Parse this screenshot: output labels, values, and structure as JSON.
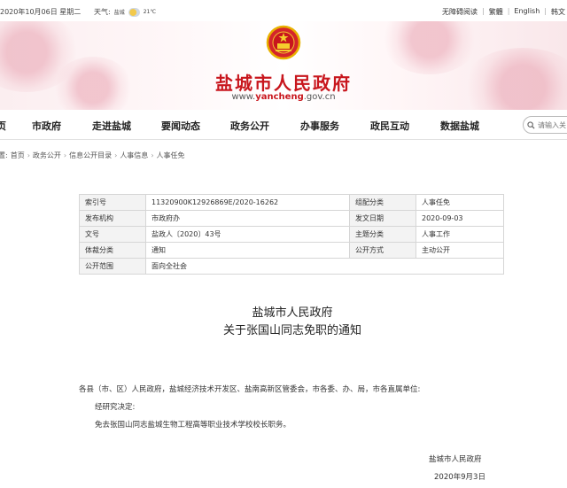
{
  "topbar": {
    "date": "2020年10月06日 星期二",
    "weather_label": "天气:",
    "city": "盐城",
    "temperature": "21℃",
    "links": [
      "无障碍阅读",
      "繁體",
      "English",
      "韩文"
    ]
  },
  "banner": {
    "site_title": "盐城市人民政府",
    "url_prefix": "www.",
    "url_domain": "yancheng",
    "url_suffix": ".gov.cn"
  },
  "nav": {
    "items": [
      "页",
      "市政府",
      "走进盐城",
      "要闻动态",
      "政务公开",
      "办事服务",
      "政民互动",
      "数据盐城"
    ],
    "search_placeholder": "请输入关"
  },
  "breadcrumb": {
    "label": "位置:",
    "items": [
      "首页",
      "政务公开",
      "信息公开目录",
      "人事信息",
      "人事任免"
    ]
  },
  "meta": {
    "rows": [
      {
        "k1": "索引号",
        "v1": "11320900K12926869E/2020-16262",
        "k2": "组配分类",
        "v2": "人事任免"
      },
      {
        "k1": "发布机构",
        "v1": "市政府办",
        "k2": "发文日期",
        "v2": "2020-09-03"
      },
      {
        "k1": "文号",
        "v1": "盐政人〔2020〕43号",
        "k2": "主题分类",
        "v2": "人事工作"
      },
      {
        "k1": "体裁分类",
        "v1": "通知",
        "k2": "公开方式",
        "v2": "主动公开"
      },
      {
        "k1": "公开范围",
        "v1": "面向全社会"
      }
    ]
  },
  "document": {
    "title_line1": "盐城市人民政府",
    "title_line2": "关于张国山同志免职的通知",
    "salutation": "各县（市、区）人民政府，盐城经济技术开发区、盐南高新区管委会，市各委、办、局，市各直属单位:",
    "para1": "经研究决定:",
    "para2": "免去张国山同志盐城生物工程高等职业技术学校校长职务。",
    "signature": "盐城市人民政府",
    "date": "2020年9月3日"
  },
  "colors": {
    "brand_red": "#c8161d",
    "table_label_bg": "#f3f3f3"
  }
}
